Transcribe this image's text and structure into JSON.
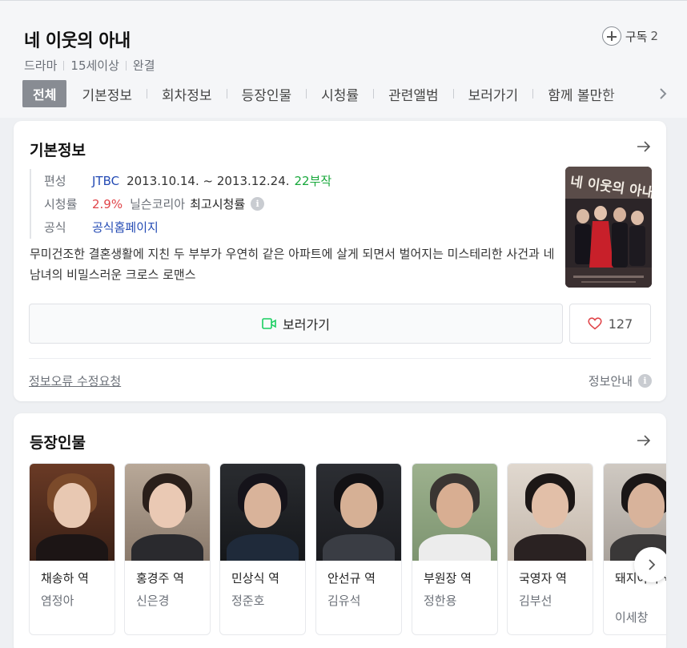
{
  "header": {
    "title": "네 이웃의 아내",
    "subscribe_label": "구독",
    "subscribe_count": "2",
    "meta": [
      "드라마",
      "15세이상",
      "완결"
    ],
    "tabs": [
      "전체",
      "기본정보",
      "회차정보",
      "등장인물",
      "시청률",
      "관련앨범",
      "보러가기",
      "함께 볼만한"
    ]
  },
  "basic_info": {
    "title": "기본정보",
    "broadcast_label": "편성",
    "channel": "JTBC",
    "period": "2013.10.14. ~ 2013.12.24.",
    "episodes": "22부작",
    "rating_label": "시청률",
    "rating_value": "2.9%",
    "rating_source": "닐슨코리아",
    "rating_type": "최고시청률",
    "official_label": "공식",
    "official_link": "공식홈페이지",
    "description": "무미건조한 결혼생활에 지친 두 부부가 우연히 같은 아파트에 살게 되면서 벌어지는 미스테리한 사건과 네 남녀의 비밀스러운 크로스 로맨스",
    "watch_label": "보러가기",
    "like_count": "127",
    "report_label": "정보오류 수정요청",
    "info_guide_label": "정보안내",
    "info_icon": "i"
  },
  "cast": {
    "title": "등장인물",
    "members": [
      {
        "role": "채송하 역",
        "actor": "염정아"
      },
      {
        "role": "홍경주 역",
        "actor": "신은경"
      },
      {
        "role": "민상식 역",
        "actor": "정준호"
      },
      {
        "role": "안선규 역",
        "actor": "김유석"
      },
      {
        "role": "부원장 역",
        "actor": "정한용"
      },
      {
        "role": "국영자 역",
        "actor": "김부선"
      },
      {
        "role": "돼지아빠 역",
        "actor": "이세창"
      }
    ]
  },
  "colors": {
    "link_blue": "#244bb4",
    "rating_red": "#e0454a",
    "episodes_green": "#18a83b",
    "watch_icon_green": "#19ce60",
    "heart_red": "#e0454a"
  }
}
